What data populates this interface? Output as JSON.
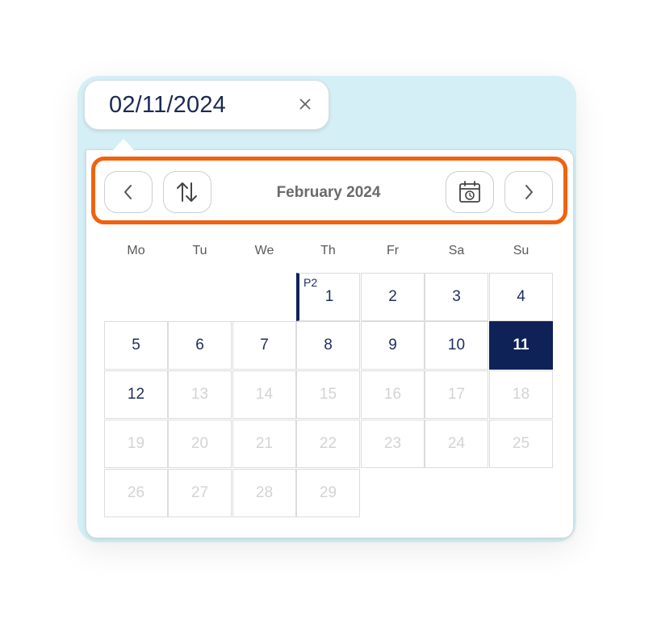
{
  "input": {
    "value": "02/11/2024"
  },
  "header": {
    "month_label": "February 2024"
  },
  "weekdays": [
    "Mo",
    "Tu",
    "We",
    "Th",
    "Fr",
    "Sa",
    "Su"
  ],
  "days": [
    {
      "label": "1",
      "marker": "P2"
    },
    {
      "label": "2"
    },
    {
      "label": "3"
    },
    {
      "label": "4"
    },
    {
      "label": "5"
    },
    {
      "label": "6"
    },
    {
      "label": "7"
    },
    {
      "label": "8"
    },
    {
      "label": "9"
    },
    {
      "label": "10"
    },
    {
      "label": "11",
      "selected": true
    },
    {
      "label": "12"
    },
    {
      "label": "13",
      "disabled": true
    },
    {
      "label": "14",
      "disabled": true
    },
    {
      "label": "15",
      "disabled": true
    },
    {
      "label": "16",
      "disabled": true
    },
    {
      "label": "17",
      "disabled": true
    },
    {
      "label": "18",
      "disabled": true
    },
    {
      "label": "19",
      "disabled": true
    },
    {
      "label": "20",
      "disabled": true
    },
    {
      "label": "21",
      "disabled": true
    },
    {
      "label": "22",
      "disabled": true
    },
    {
      "label": "23",
      "disabled": true
    },
    {
      "label": "24",
      "disabled": true
    },
    {
      "label": "25",
      "disabled": true
    },
    {
      "label": "26",
      "disabled": true
    },
    {
      "label": "27",
      "disabled": true
    },
    {
      "label": "28",
      "disabled": true
    },
    {
      "label": "29",
      "disabled": true
    }
  ],
  "icons": {
    "clear": "close-icon",
    "prev": "chevron-left-icon",
    "view_toggle": "sort-arrows-icon",
    "today": "calendar-clock-icon",
    "next": "chevron-right-icon"
  },
  "colors": {
    "highlight": "#f0620f",
    "selected": "#0e2257",
    "text": "#1e2d5f",
    "disabled": "#d3d3d3",
    "frame": "#d4eff5"
  }
}
